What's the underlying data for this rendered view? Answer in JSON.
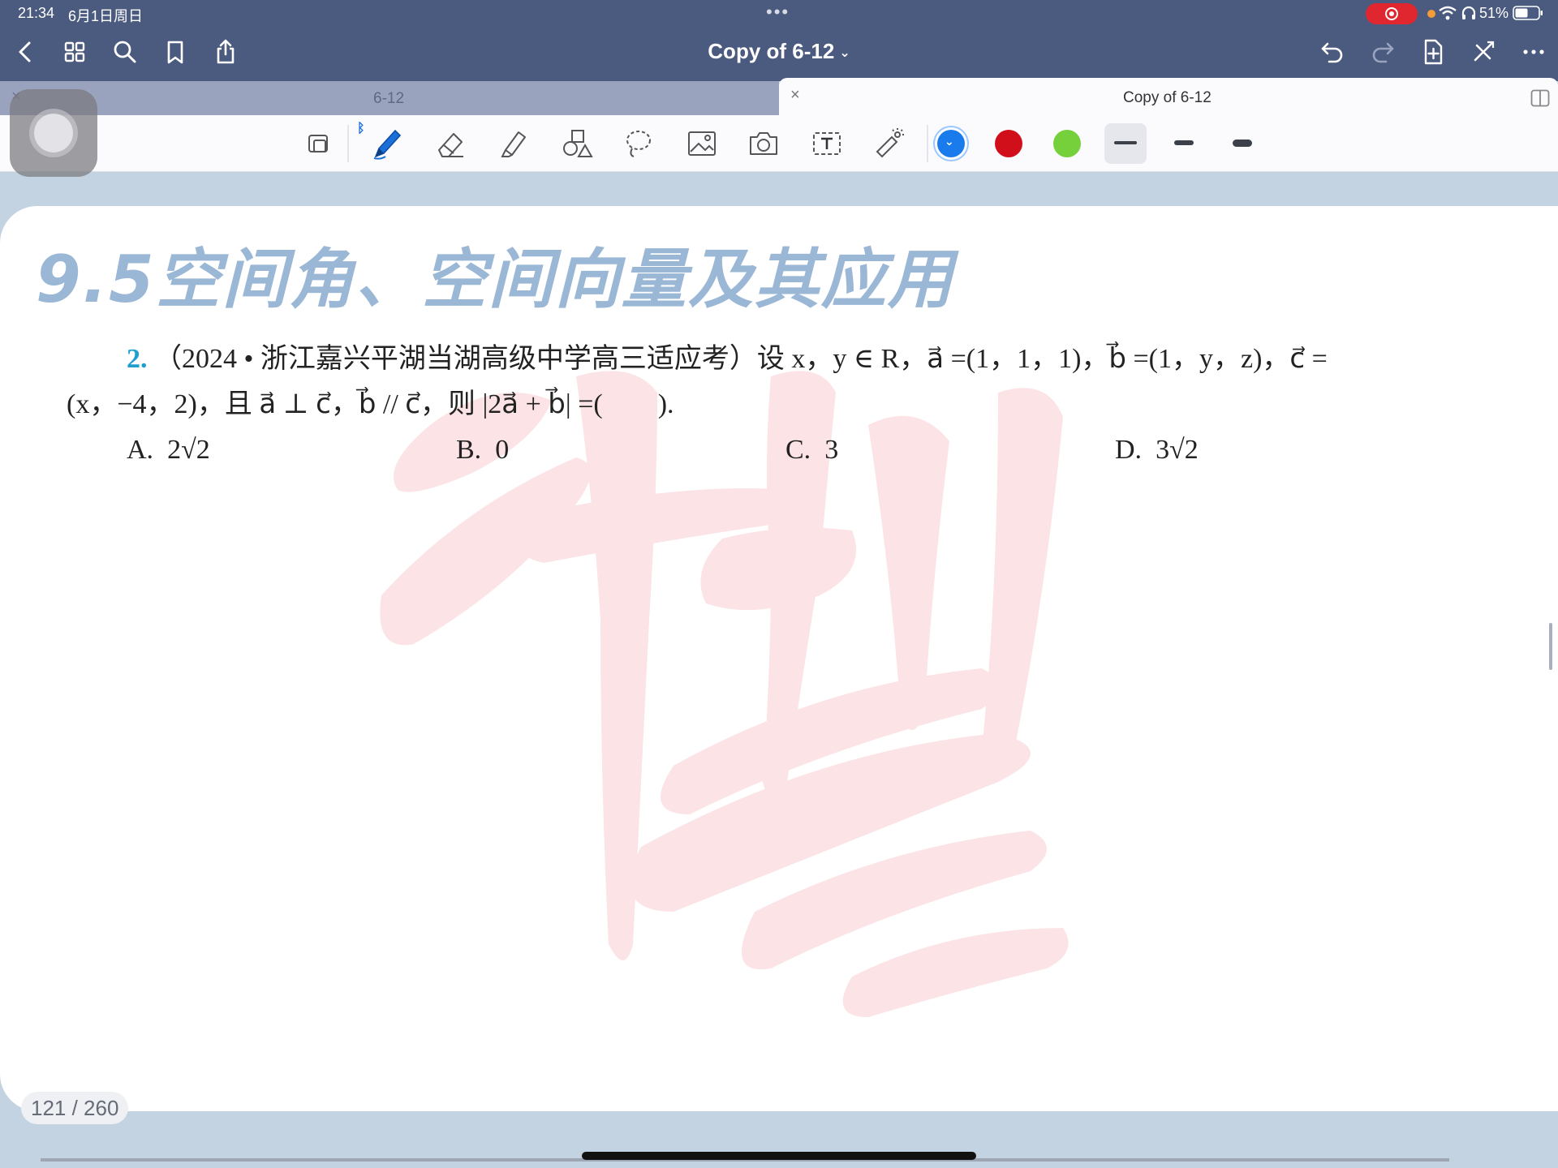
{
  "status_bar": {
    "time": "21:34",
    "date": "6月1日周日",
    "battery": "51%"
  },
  "nav": {
    "title": "Copy of 6-12",
    "title_chevron": "⌄",
    "icons": [
      "back-chevron-icon",
      "grid-icon",
      "search-icon",
      "bookmark-icon",
      "share-icon",
      "undo-icon",
      "redo-icon",
      "add-page-icon",
      "close-x-icon",
      "more-icon"
    ]
  },
  "tabs": [
    {
      "label": "6-12",
      "active": false,
      "close": "×"
    },
    {
      "label": "Copy of 6-12",
      "active": true,
      "close": "×"
    }
  ],
  "toolbar": {
    "bluetooth": "ᛒ",
    "tools": [
      "zoom-box-icon",
      "pen-icon",
      "eraser-icon",
      "highlighter-icon",
      "shapes-icon",
      "lasso-icon",
      "image-icon",
      "camera-icon",
      "text-box-icon",
      "laser-pointer-icon"
    ],
    "colors": [
      "#1a7cec",
      "#d10f1b",
      "#75d03b"
    ],
    "selected_color": "#1a7cec",
    "check": "⌄"
  },
  "page": {
    "section_title": "9.5空间角、空间向量及其应用",
    "question_number": "2.",
    "question_line1": "（2024 • 浙江嘉兴平湖当湖高级中学高三适应考）设 x，y ∈ R，a⃗ =(1，1，1)，b⃗ =(1，y，z)，c⃗ =",
    "question_line2": "(x，−4，2)，且 a⃗ ⊥ c⃗，b⃗ // c⃗，则 |2a⃗ + b⃗| =(　　).",
    "options": [
      {
        "label": "A.",
        "value": "2√2"
      },
      {
        "label": "B.",
        "value": "0"
      },
      {
        "label": "C.",
        "value": "3"
      },
      {
        "label": "D.",
        "value": "3√2"
      }
    ]
  },
  "page_counter": "121 / 260"
}
